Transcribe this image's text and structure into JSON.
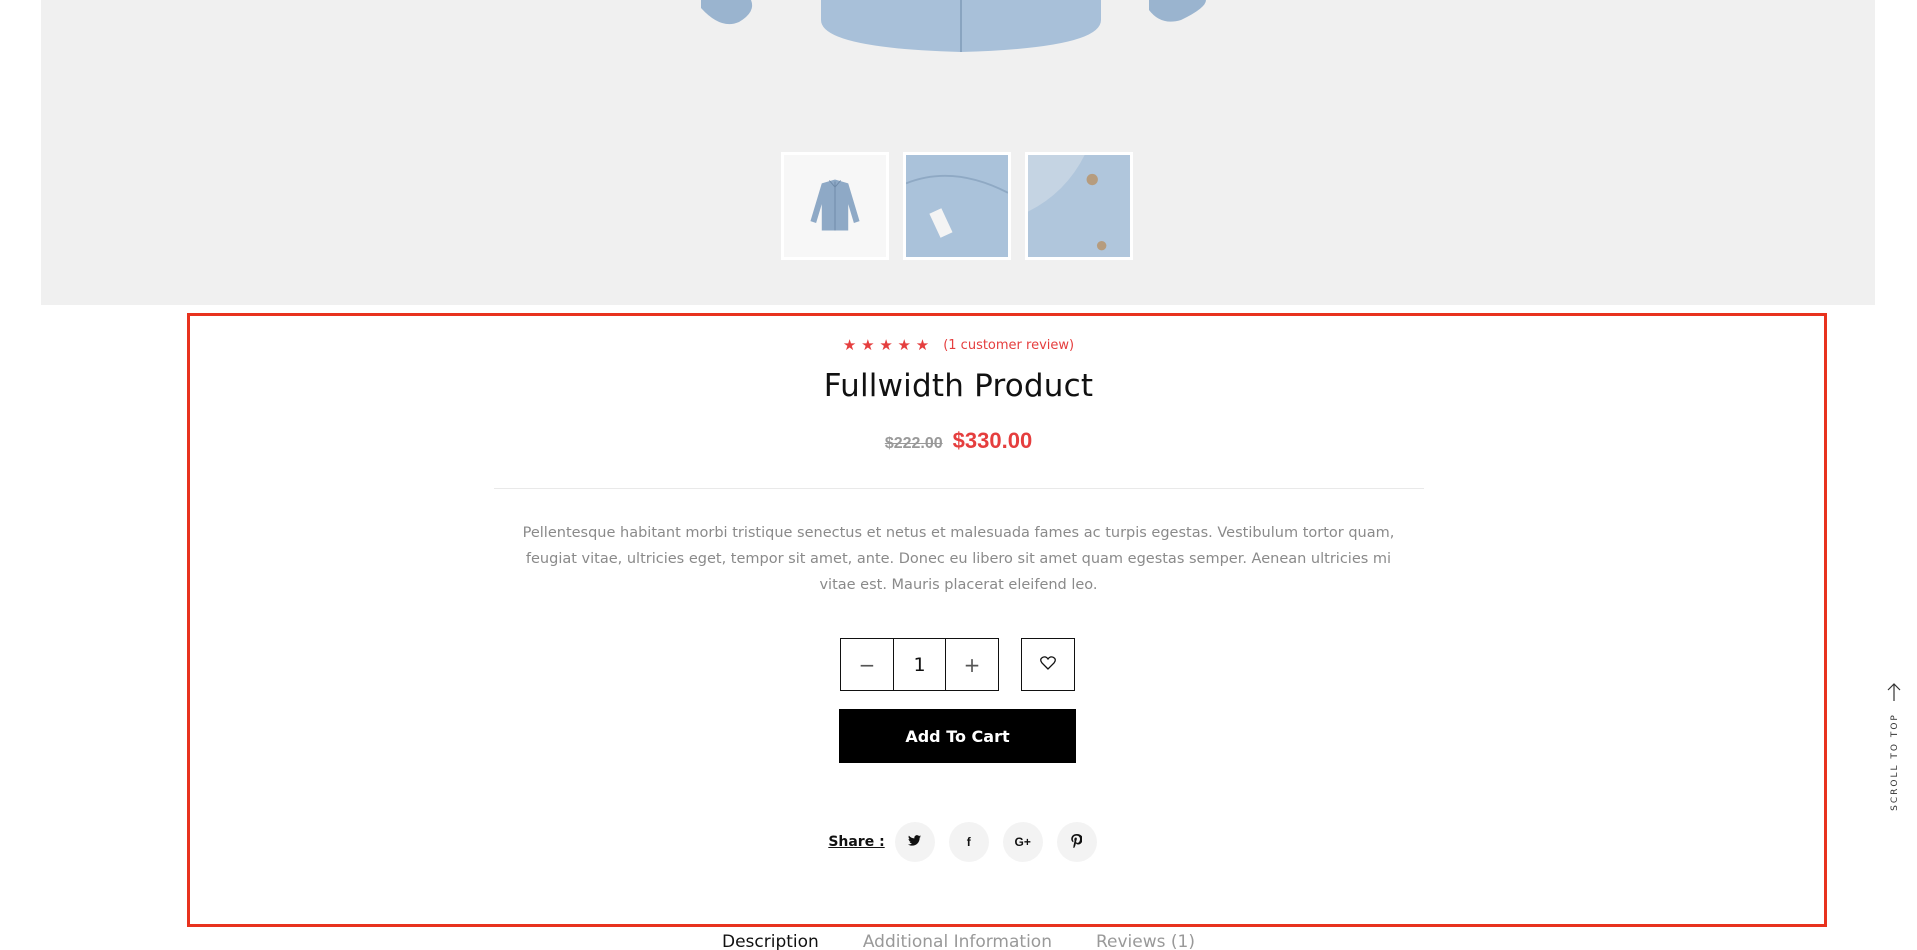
{
  "gallery": {
    "thumbnails": [
      {
        "icon": "shirt-front-thumbnail",
        "active": true
      },
      {
        "icon": "shirt-detail-thumbnail",
        "active": false
      },
      {
        "icon": "shirt-collar-thumbnail",
        "active": false
      }
    ]
  },
  "product": {
    "rating_stars": "★ ★ ★ ★ ★",
    "rating_value": 5,
    "review_link": "(1 customer review)",
    "title": "Fullwidth Product",
    "old_price": "$222.00",
    "new_price": "$330.00",
    "description": "Pellentesque habitant morbi tristique senectus et netus et malesuada fames ac turpis egestas. Vestibulum tortor quam, feugiat vitae, ultricies eget, tempor sit amet, ante. Donec eu libero sit amet quam egestas semper. Aenean ultricies mi vitae est. Mauris placerat eleifend leo."
  },
  "cart": {
    "minus": "−",
    "quantity": "1",
    "plus": "+",
    "add_to_cart": "Add To Cart"
  },
  "share": {
    "label": "Share :",
    "icons": [
      "twitter-icon",
      "facebook-icon",
      "google-plus-icon",
      "pinterest-icon"
    ],
    "google_plus": "G+",
    "facebook": "f"
  },
  "tabs": [
    "Description",
    "Additional Information",
    "Reviews (1)"
  ],
  "scroll_top": "SCROLL TO TOP",
  "colors": {
    "accent": "#e53e3e",
    "highlight_frame": "#e8321e",
    "button": "#000000"
  }
}
